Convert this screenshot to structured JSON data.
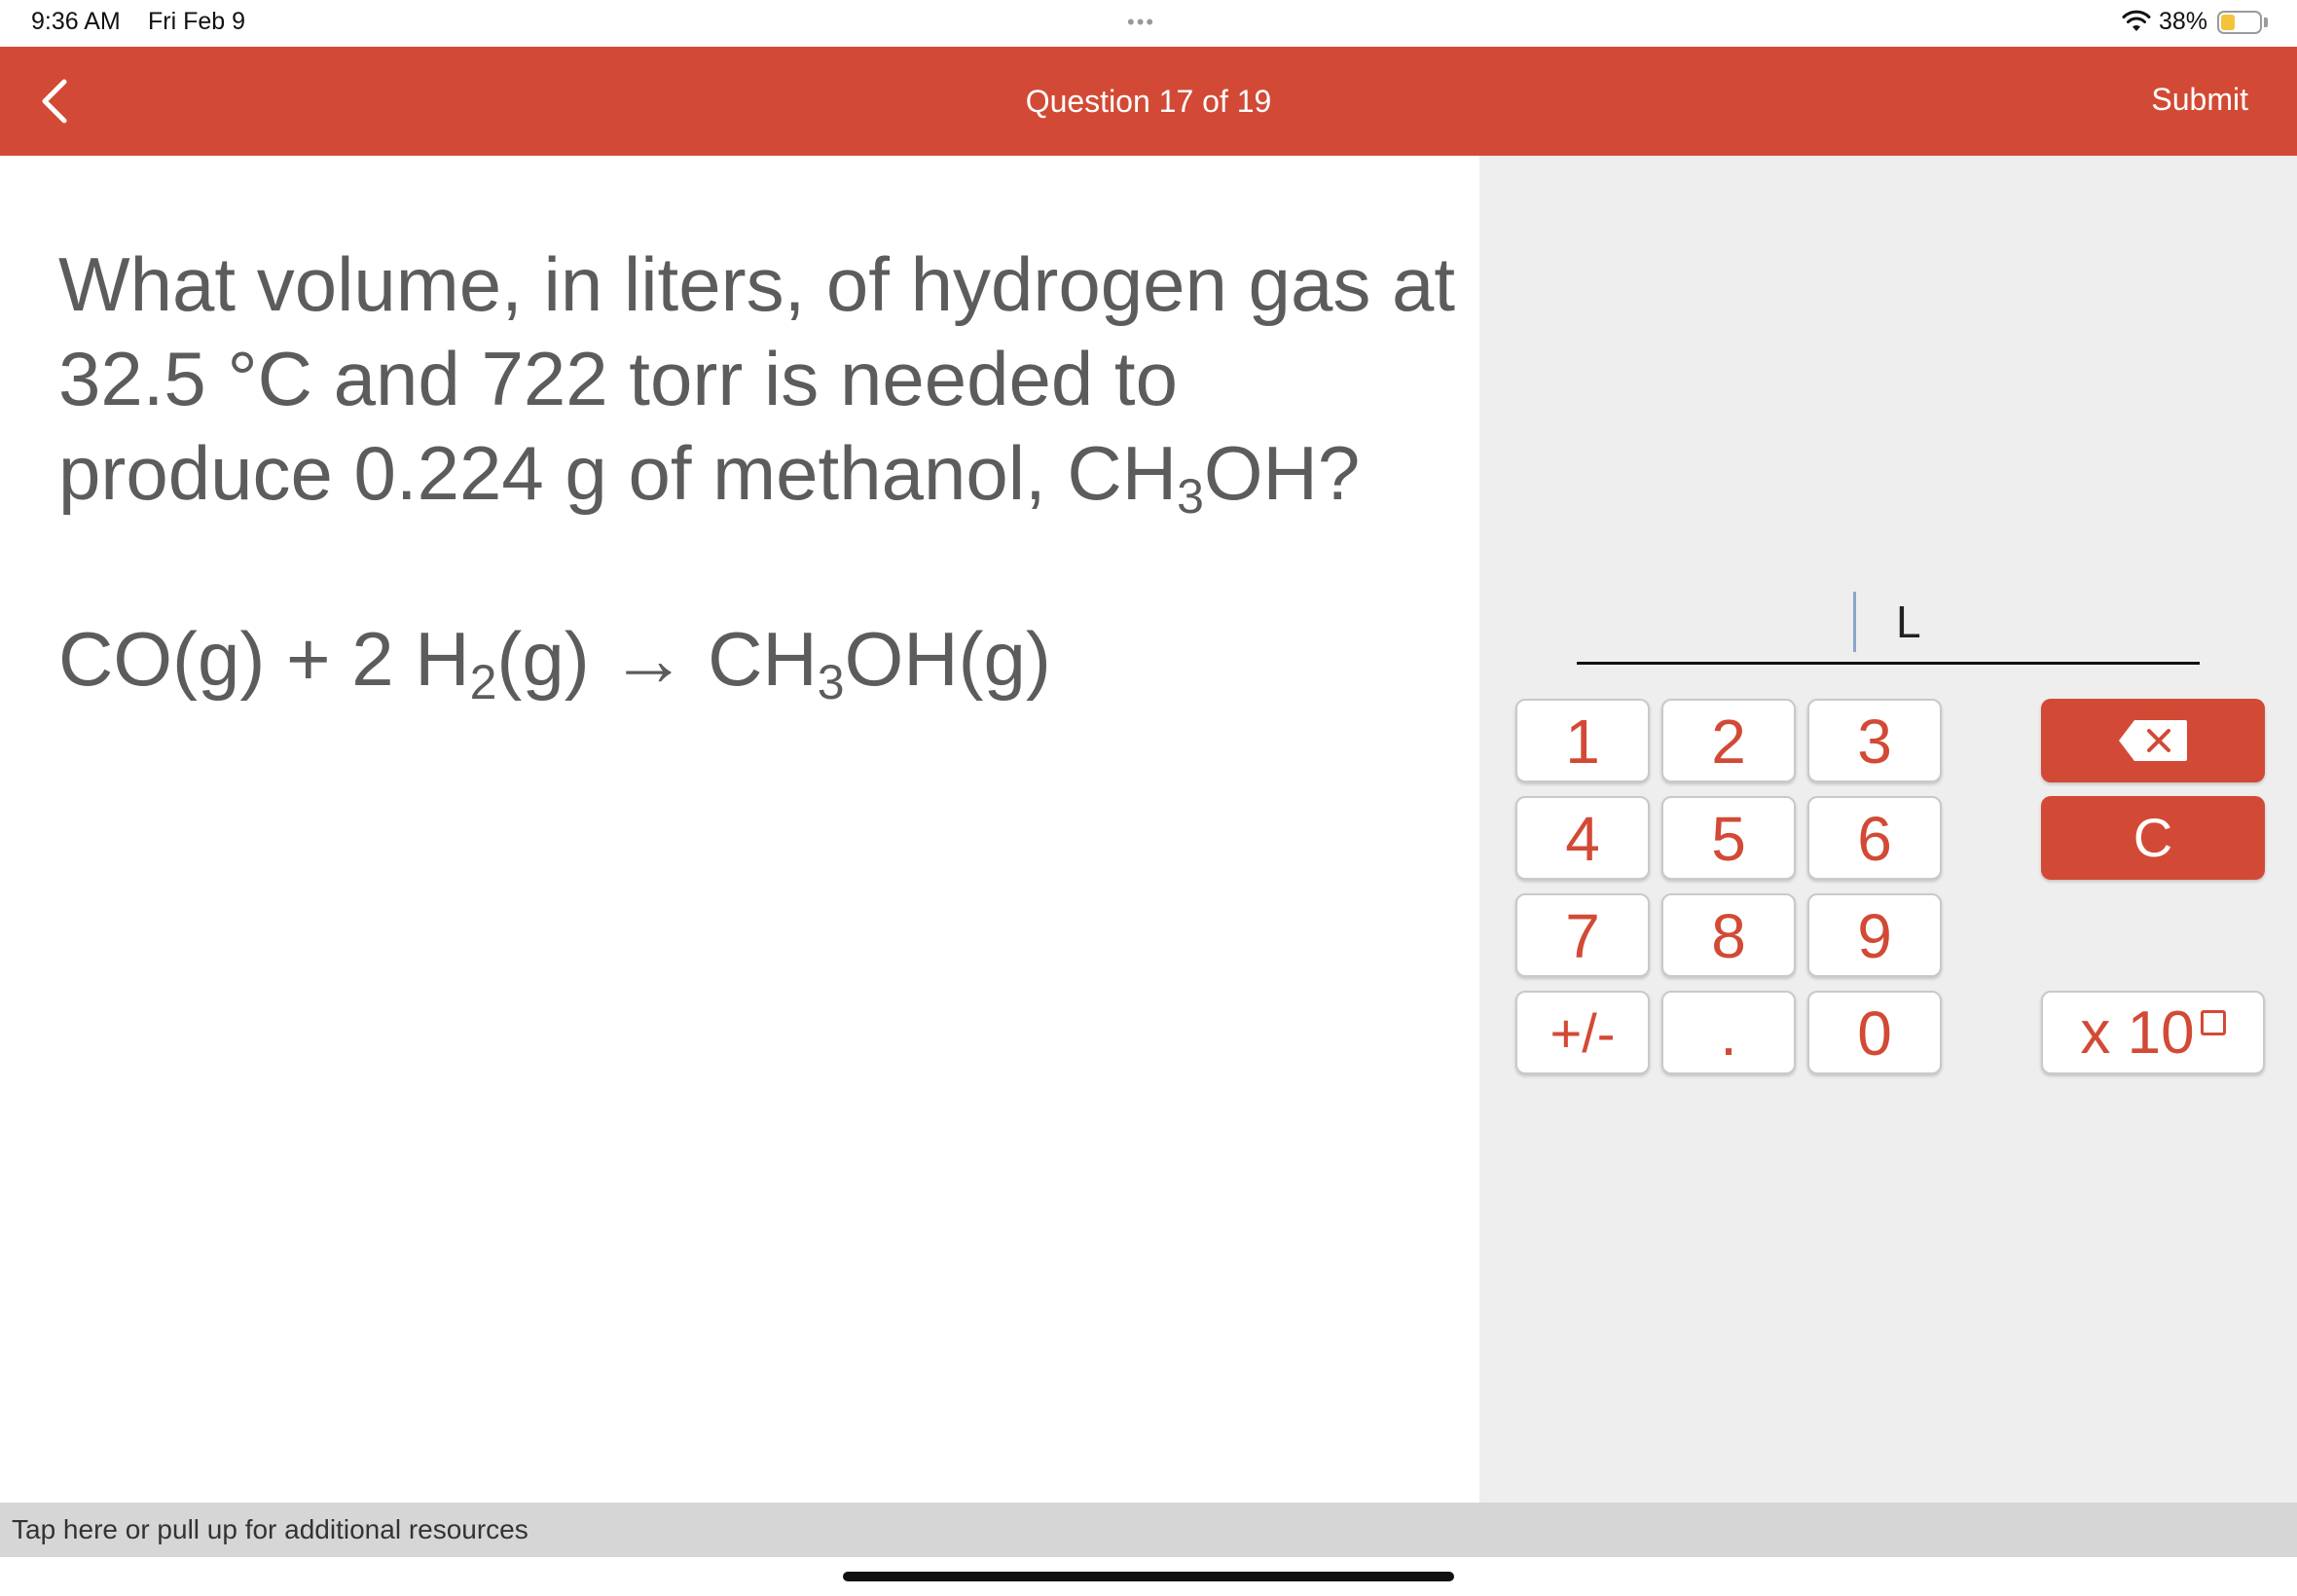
{
  "status_bar": {
    "time": "9:36 AM",
    "date": "Fri Feb 9",
    "dots": "•••",
    "battery_percent": "38%",
    "battery_level": 0.38,
    "wifi_icon": "wifi-icon"
  },
  "header": {
    "title": "Question 17 of 19",
    "submit_label": "Submit",
    "back_icon": "chevron-left-icon",
    "color": "#d24a35"
  },
  "question": {
    "line1": "What volume, in liters, of hydrogen gas at",
    "line2": "32.5 °C and 722 torr is needed to",
    "line3_pre": "produce 0.224 g of methanol, CH",
    "line3_sub": "3",
    "line3_post": "OH?"
  },
  "equation": {
    "part1": "CO(g) + 2 H",
    "sub1": "2",
    "part2": "(g) → CH",
    "sub2": "3",
    "part3": "OH(g)"
  },
  "answer": {
    "value": "",
    "unit": "L"
  },
  "keypad": {
    "k1": "1",
    "k2": "2",
    "k3": "3",
    "k4": "4",
    "k5": "5",
    "k6": "6",
    "k7": "7",
    "k8": "8",
    "k9": "9",
    "plus_minus": "+/-",
    "decimal": ".",
    "k0": "0",
    "backspace_icon": "backspace-icon",
    "clear": "C",
    "exponent": "x 10"
  },
  "resources": {
    "label": "Tap here or pull up for additional resources"
  }
}
